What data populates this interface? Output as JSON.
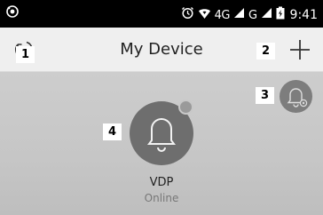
{
  "status_bar": {
    "network": "4G",
    "network2": "G",
    "time": "9:41"
  },
  "header": {
    "title": "My Device"
  },
  "badges": {
    "refresh": "1",
    "add": "2",
    "settings": "3",
    "device": "4"
  },
  "device": {
    "name": "VDP",
    "status": "Online"
  },
  "icons": {
    "status_left": "eye-app-icon",
    "alarm": "alarm-clock-icon",
    "heart_wifi": "heart-wifi-icon",
    "signal": "cell-signal-icon",
    "battery": "battery-charging-icon",
    "refresh": "refresh-icon",
    "add": "plus-icon",
    "settings": "bell-gear-icon",
    "device": "bell-icon"
  },
  "colors": {
    "status_bar_bg": "#000000",
    "header_bg": "#efefef",
    "main_bg": "#c9c9c9",
    "device_circle": "#6e6e6e",
    "settings_circle": "#7d7d7d"
  }
}
